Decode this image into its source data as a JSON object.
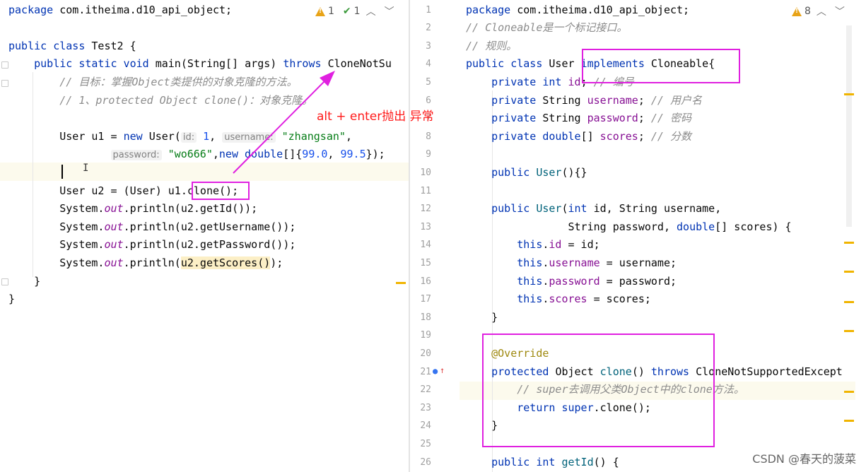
{
  "left_editor": {
    "lines": [
      {
        "segments": [
          {
            "t": "package ",
            "c": "kw"
          },
          {
            "t": "com.itheima.d10_api_object;",
            "c": ""
          }
        ]
      },
      {
        "segments": []
      },
      {
        "segments": [
          {
            "t": "public class ",
            "c": "kw"
          },
          {
            "t": "Test2 {",
            "c": ""
          }
        ]
      },
      {
        "segments": [
          {
            "t": "    public static void ",
            "c": "kw"
          },
          {
            "t": "main(String[] args) ",
            "c": ""
          },
          {
            "t": "throws ",
            "c": "kw"
          },
          {
            "t": "CloneNotSu",
            "c": ""
          }
        ]
      },
      {
        "segments": [
          {
            "t": "        // 目标：掌握Object类提供的对象克隆的方法。",
            "c": "cm"
          }
        ]
      },
      {
        "segments": [
          {
            "t": "        // 1、protected Object clone()：对象克隆。",
            "c": "cm"
          }
        ]
      },
      {
        "segments": []
      },
      {
        "segments": [
          {
            "t": "        User u1 = ",
            "c": ""
          },
          {
            "t": "new ",
            "c": "kw"
          },
          {
            "t": "User(",
            "c": ""
          },
          {
            "t": "id:",
            "c": "hint"
          },
          {
            "t": " 1",
            "c": "num"
          },
          {
            "t": ", ",
            "c": ""
          },
          {
            "t": "username:",
            "c": "hint"
          },
          {
            "t": " ",
            "c": ""
          },
          {
            "t": "\"zhangsan\"",
            "c": "st"
          },
          {
            "t": ",",
            "c": ""
          }
        ]
      },
      {
        "segments": [
          {
            "t": "                ",
            "c": ""
          },
          {
            "t": "password:",
            "c": "hint"
          },
          {
            "t": " ",
            "c": ""
          },
          {
            "t": "\"wo666\"",
            "c": "st"
          },
          {
            "t": ",",
            "c": ""
          },
          {
            "t": "new ",
            "c": "kw"
          },
          {
            "t": "double",
            "c": "kw"
          },
          {
            "t": "[]{",
            "c": ""
          },
          {
            "t": "99.0",
            "c": "num"
          },
          {
            "t": ", ",
            "c": ""
          },
          {
            "t": "99.5",
            "c": "num"
          },
          {
            "t": "});",
            "c": ""
          }
        ]
      },
      {
        "segments": []
      },
      {
        "segments": [
          {
            "t": "        User u2 = (User) u1.",
            "c": ""
          },
          {
            "t": "clone();",
            "c": ""
          }
        ]
      },
      {
        "segments": [
          {
            "t": "        System.",
            "c": ""
          },
          {
            "t": "out",
            "c": "it"
          },
          {
            "t": ".println(u2.getId());",
            "c": ""
          }
        ]
      },
      {
        "segments": [
          {
            "t": "        System.",
            "c": ""
          },
          {
            "t": "out",
            "c": "it"
          },
          {
            "t": ".println(u2.getUsername());",
            "c": ""
          }
        ]
      },
      {
        "segments": [
          {
            "t": "        System.",
            "c": ""
          },
          {
            "t": "out",
            "c": "it"
          },
          {
            "t": ".println(u2.getPassword());",
            "c": ""
          }
        ]
      },
      {
        "segments": [
          {
            "t": "        System.",
            "c": ""
          },
          {
            "t": "out",
            "c": "it"
          },
          {
            "t": ".println(",
            "c": ""
          },
          {
            "t": "u2.getScores()",
            "c": "warn-hl"
          },
          {
            "t": ");",
            "c": ""
          }
        ]
      },
      {
        "segments": [
          {
            "t": "    }",
            "c": ""
          }
        ]
      },
      {
        "segments": [
          {
            "t": "}",
            "c": ""
          }
        ]
      }
    ],
    "warnings": "1",
    "weak_warnings": "1"
  },
  "right_editor": {
    "line_numbers": [
      "1",
      "2",
      "3",
      "4",
      "5",
      "6",
      "7",
      "8",
      "9",
      "10",
      "11",
      "12",
      "13",
      "14",
      "15",
      "16",
      "17",
      "18",
      "19",
      "20",
      "21",
      "22",
      "23",
      "24",
      "25",
      "26"
    ],
    "lines": [
      {
        "segments": [
          {
            "t": "package ",
            "c": "kw"
          },
          {
            "t": "com.itheima.d10_api_object;",
            "c": ""
          }
        ]
      },
      {
        "segments": [
          {
            "t": "// Cloneable是一个标记接口。",
            "c": "cm"
          }
        ]
      },
      {
        "segments": [
          {
            "t": "// 规则。",
            "c": "cm"
          }
        ]
      },
      {
        "segments": [
          {
            "t": "public class ",
            "c": "kw"
          },
          {
            "t": "User ",
            "c": ""
          },
          {
            "t": "implements ",
            "c": "kw"
          },
          {
            "t": "Cloneable{",
            "c": ""
          }
        ]
      },
      {
        "segments": [
          {
            "t": "    private int ",
            "c": "kw"
          },
          {
            "t": "id",
            "c": "fld"
          },
          {
            "t": "; ",
            "c": ""
          },
          {
            "t": "// 编号",
            "c": "cm"
          }
        ]
      },
      {
        "segments": [
          {
            "t": "    private ",
            "c": "kw"
          },
          {
            "t": "String ",
            "c": ""
          },
          {
            "t": "username",
            "c": "fld"
          },
          {
            "t": "; ",
            "c": ""
          },
          {
            "t": "// 用户名",
            "c": "cm"
          }
        ]
      },
      {
        "segments": [
          {
            "t": "    private ",
            "c": "kw"
          },
          {
            "t": "String ",
            "c": ""
          },
          {
            "t": "password",
            "c": "fld"
          },
          {
            "t": "; ",
            "c": ""
          },
          {
            "t": "// 密码",
            "c": "cm"
          }
        ]
      },
      {
        "segments": [
          {
            "t": "    private double",
            "c": "kw"
          },
          {
            "t": "[] ",
            "c": ""
          },
          {
            "t": "scores",
            "c": "fld"
          },
          {
            "t": "; ",
            "c": ""
          },
          {
            "t": "// 分数",
            "c": "cm"
          }
        ]
      },
      {
        "segments": []
      },
      {
        "segments": [
          {
            "t": "    public ",
            "c": "kw"
          },
          {
            "t": "User",
            "c": "fn"
          },
          {
            "t": "(){}",
            "c": ""
          }
        ]
      },
      {
        "segments": []
      },
      {
        "segments": [
          {
            "t": "    public ",
            "c": "kw"
          },
          {
            "t": "User",
            "c": "fn"
          },
          {
            "t": "(",
            "c": ""
          },
          {
            "t": "int ",
            "c": "kw"
          },
          {
            "t": "id, String username,",
            "c": ""
          }
        ]
      },
      {
        "segments": [
          {
            "t": "                String password, ",
            "c": ""
          },
          {
            "t": "double",
            "c": "kw"
          },
          {
            "t": "[] scores) {",
            "c": ""
          }
        ]
      },
      {
        "segments": [
          {
            "t": "        ",
            "c": ""
          },
          {
            "t": "this",
            "c": "kw"
          },
          {
            "t": ".",
            "c": ""
          },
          {
            "t": "id",
            "c": "fld"
          },
          {
            "t": " = id;",
            "c": ""
          }
        ]
      },
      {
        "segments": [
          {
            "t": "        ",
            "c": ""
          },
          {
            "t": "this",
            "c": "kw"
          },
          {
            "t": ".",
            "c": ""
          },
          {
            "t": "username",
            "c": "fld"
          },
          {
            "t": " = username;",
            "c": ""
          }
        ]
      },
      {
        "segments": [
          {
            "t": "        ",
            "c": ""
          },
          {
            "t": "this",
            "c": "kw"
          },
          {
            "t": ".",
            "c": ""
          },
          {
            "t": "password",
            "c": "fld"
          },
          {
            "t": " = password;",
            "c": ""
          }
        ]
      },
      {
        "segments": [
          {
            "t": "        ",
            "c": ""
          },
          {
            "t": "this",
            "c": "kw"
          },
          {
            "t": ".",
            "c": ""
          },
          {
            "t": "scores",
            "c": "fld"
          },
          {
            "t": " = scores;",
            "c": ""
          }
        ]
      },
      {
        "segments": [
          {
            "t": "    }",
            "c": ""
          }
        ]
      },
      {
        "segments": []
      },
      {
        "segments": [
          {
            "t": "    @Override",
            "c": "ann"
          }
        ]
      },
      {
        "segments": [
          {
            "t": "    protected ",
            "c": "kw"
          },
          {
            "t": "Object ",
            "c": ""
          },
          {
            "t": "clone",
            "c": "fn"
          },
          {
            "t": "() ",
            "c": ""
          },
          {
            "t": "throws ",
            "c": "kw"
          },
          {
            "t": "CloneNotSupportedExcept",
            "c": ""
          }
        ]
      },
      {
        "segments": [
          {
            "t": "        // super去调用父类Object中的clone方法。",
            "c": "cm"
          }
        ]
      },
      {
        "segments": [
          {
            "t": "        ",
            "c": ""
          },
          {
            "t": "return super",
            "c": "kw"
          },
          {
            "t": ".clone();",
            "c": ""
          }
        ]
      },
      {
        "segments": [
          {
            "t": "    }",
            "c": ""
          }
        ]
      },
      {
        "segments": []
      },
      {
        "segments": [
          {
            "t": "    public int ",
            "c": "kw"
          },
          {
            "t": "getId",
            "c": "fn"
          },
          {
            "t": "() {",
            "c": ""
          }
        ]
      }
    ],
    "warnings": "8"
  },
  "annotation_text": "alt + enter抛出 异常",
  "watermark": "CSDN @春天的菠菜",
  "colors": {
    "annotation_box": "#e020e0",
    "annotation_text": "#ff1a1a",
    "warning_stripe": "#f0b400"
  }
}
